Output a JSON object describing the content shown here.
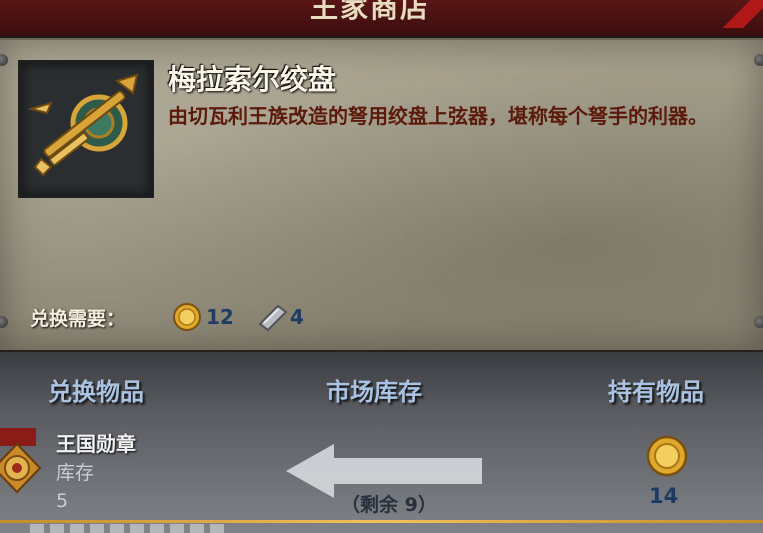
{
  "header": {
    "title": "王家商店"
  },
  "item": {
    "name": "梅拉索尔绞盘",
    "description": "由切瓦利王族改造的弩用绞盘上弦器，堪称每个弩手的利器。",
    "icon": "crossbow-winch-icon"
  },
  "cost": {
    "label": "兑换需要：",
    "coin_amount": "12",
    "stone_amount": "4",
    "coin_icon": "gold-coin-icon",
    "stone_icon": "whetstone-icon"
  },
  "exchange": {
    "headers": {
      "exchange_item": "兑换物品",
      "market_stock": "市场库存",
      "owned": "持有物品"
    },
    "medal": {
      "name": "王国勋章",
      "stock_label": "库存",
      "stock_value": "5",
      "icon": "kingdom-medal-icon"
    },
    "remaining": "（剩余 9）",
    "owned_count": "14",
    "owned_icon": "gold-coin-icon"
  },
  "colors": {
    "header_text": "#aac3e2",
    "desc_text": "#5b1a0c",
    "banner": "#5a1616",
    "accent_gold": "#d9a53a"
  }
}
